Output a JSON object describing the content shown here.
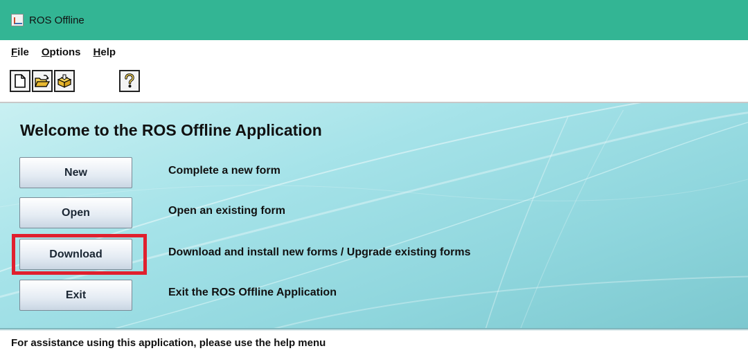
{
  "window": {
    "title": "ROS Offline",
    "icon": "java-icon"
  },
  "menu": {
    "items": [
      {
        "label": "File",
        "mnemonic": "F",
        "rest": "ile"
      },
      {
        "label": "Options",
        "mnemonic": "O",
        "rest": "ptions"
      },
      {
        "label": "Help",
        "mnemonic": "H",
        "rest": "elp"
      }
    ]
  },
  "toolbar": {
    "buttons": [
      {
        "name": "new-form",
        "icon": "blank-page-icon"
      },
      {
        "name": "open-form",
        "icon": "open-folder-icon"
      },
      {
        "name": "download-forms",
        "icon": "download-box-icon"
      },
      {
        "name": "help",
        "icon": "question-mark-icon"
      }
    ]
  },
  "welcome": {
    "title": "Welcome to the ROS Offline Application",
    "actions": [
      {
        "label": "New",
        "description": "Complete a new form"
      },
      {
        "label": "Open",
        "description": "Open an existing form"
      },
      {
        "label": "Download",
        "description": "Download and install new forms / Upgrade existing forms",
        "highlighted": true
      },
      {
        "label": "Exit",
        "description": "Exit the ROS Offline Application"
      }
    ]
  },
  "status": {
    "text": "For assistance using this application, please use the help menu"
  },
  "colors": {
    "titlebar": "#33b594",
    "highlight": "#e0202e",
    "panel": "#a6e3e9"
  }
}
